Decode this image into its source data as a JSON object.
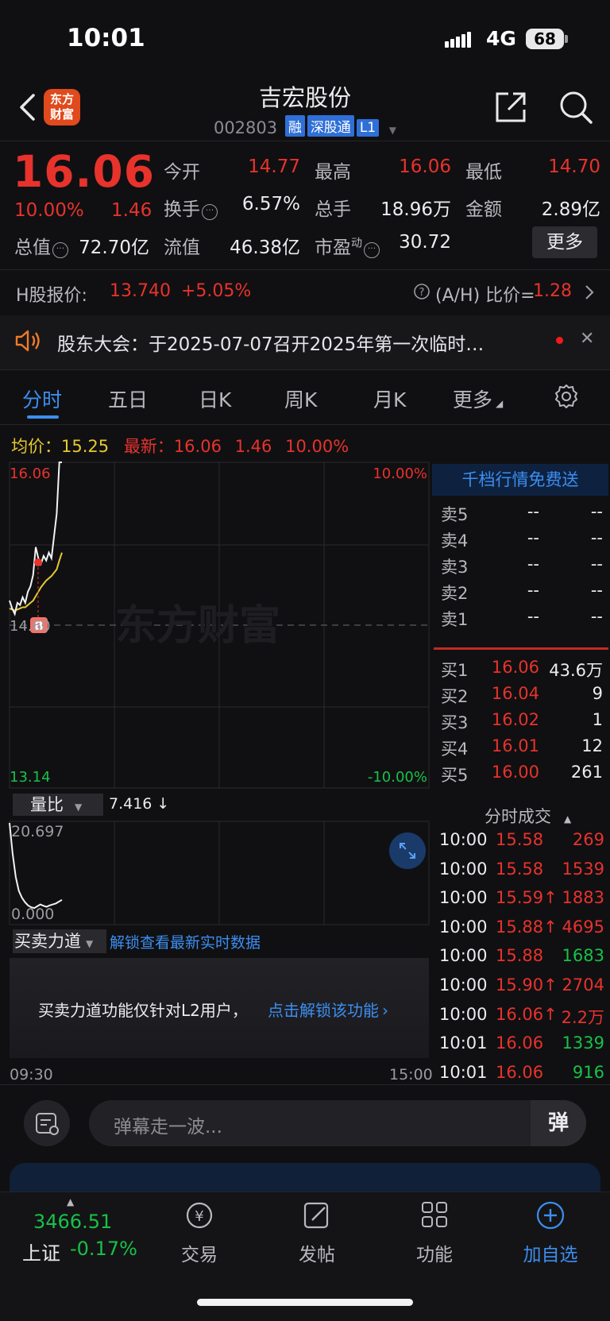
{
  "status_bar": {
    "time": "10:01",
    "network": "4G",
    "battery": "68"
  },
  "header": {
    "logo_text": "东方财富",
    "stock_name": "吉宏股份",
    "stock_code": "002803",
    "tags": [
      "融",
      "深股通",
      "L1"
    ]
  },
  "quote": {
    "price": "16.06",
    "change_pct": "10.00%",
    "change": "1.46",
    "fields": [
      {
        "label": "今开",
        "value": "14.77",
        "color": "red"
      },
      {
        "label": "最高",
        "value": "16.06",
        "color": "red"
      },
      {
        "label": "最低",
        "value": "14.70",
        "color": "red"
      },
      {
        "label": "换手",
        "value": "6.57%",
        "color": "white"
      },
      {
        "label": "总手",
        "value": "18.96万",
        "color": "white"
      },
      {
        "label": "金额",
        "value": "2.89亿",
        "color": "white"
      },
      {
        "label": "总值",
        "value": "72.70亿",
        "color": "white"
      },
      {
        "label": "流值",
        "value": "46.38亿",
        "color": "white"
      },
      {
        "label": "市盈",
        "value": "30.72",
        "color": "white"
      }
    ],
    "pe_superscript": "动",
    "more_label": "更多"
  },
  "hshare": {
    "label": "H股报价:",
    "price": "13.740",
    "pct": "+5.05%",
    "ah_label": "(A/H) 比价=",
    "ah_value": "1.28"
  },
  "notice": {
    "text": "股东大会：于2025-07-07召开2025年第一次临时…"
  },
  "tabs": [
    {
      "label": "分时",
      "active": true
    },
    {
      "label": "五日"
    },
    {
      "label": "日K"
    },
    {
      "label": "周K"
    },
    {
      "label": "月K"
    },
    {
      "label": "更多"
    }
  ],
  "chart_info": {
    "avg_label": "均价：",
    "avg_value": "15.25",
    "latest_label": "最新：",
    "latest_value": "16.06",
    "latest_change": "1.46",
    "latest_pct": "10.00%"
  },
  "chart_data": {
    "type": "line",
    "y_top_left": "16.06",
    "y_mid_left": "14.60",
    "y_bottom_left": "13.14",
    "y_top_right": "10.00%",
    "y_bottom_right": "-10.00%",
    "ylim": [
      13.14,
      16.06
    ],
    "x_start": "09:30",
    "x_end": "15:00",
    "watermark": "东方财富",
    "buy_marker": "B",
    "series": [
      {
        "values": [
          14.82,
          14.75,
          14.7,
          14.8,
          14.78,
          14.85,
          14.8,
          14.9,
          14.95,
          15.05,
          15.3,
          15.2,
          15.15,
          15.22,
          15.18,
          15.25,
          15.2,
          15.4,
          15.6,
          16.06,
          16.06
        ]
      },
      {
        "values": [
          14.75,
          14.74,
          14.73,
          14.74,
          14.75,
          14.76,
          14.76,
          14.78,
          14.8,
          14.82,
          14.86,
          14.9,
          14.94,
          14.97,
          15.0,
          15.02,
          15.04,
          15.07,
          15.1,
          15.18,
          15.25
        ]
      }
    ]
  },
  "volume_panel": {
    "indicator_label": "量比",
    "indicator_value": "7.416 ↓",
    "max": "20.697",
    "min": "0.000",
    "values": [
      20.697,
      14.0,
      9.0,
      6.0,
      4.5,
      3.5,
      2.8,
      2.4,
      2.2,
      2.6,
      3.0,
      2.7,
      2.5,
      2.8,
      3.0,
      3.2,
      3.6,
      4.0
    ]
  },
  "force_panel": {
    "label": "买卖力道",
    "unlock_link": "解锁查看最新实时数据",
    "lock_text": "买卖力道功能仅针对L2用户，",
    "lock_link": "点击解锁该功能"
  },
  "order_book": {
    "header": "千档行情免费送",
    "asks": [
      {
        "label": "卖5",
        "price": "--",
        "vol": "--"
      },
      {
        "label": "卖4",
        "price": "--",
        "vol": "--"
      },
      {
        "label": "卖3",
        "price": "--",
        "vol": "--"
      },
      {
        "label": "卖2",
        "price": "--",
        "vol": "--"
      },
      {
        "label": "卖1",
        "price": "--",
        "vol": "--"
      }
    ],
    "bids": [
      {
        "label": "买1",
        "price": "16.06",
        "vol": "43.6万"
      },
      {
        "label": "买2",
        "price": "16.04",
        "vol": "9"
      },
      {
        "label": "买3",
        "price": "16.02",
        "vol": "1"
      },
      {
        "label": "买4",
        "price": "16.01",
        "vol": "12"
      },
      {
        "label": "买5",
        "price": "16.00",
        "vol": "261"
      }
    ]
  },
  "ticks": {
    "header": "分时成交",
    "rows": [
      {
        "time": "10:00",
        "price": "15.58",
        "vol": "269",
        "vol_color": "red"
      },
      {
        "time": "10:00",
        "price": "15.58",
        "vol": "1539",
        "vol_color": "red"
      },
      {
        "time": "10:00",
        "price": "15.59↑",
        "vol": "1883",
        "vol_color": "red"
      },
      {
        "time": "10:00",
        "price": "15.88↑",
        "vol": "4695",
        "vol_color": "red"
      },
      {
        "time": "10:00",
        "price": "15.88",
        "vol": "1683",
        "vol_color": "green"
      },
      {
        "time": "10:00",
        "price": "15.90↑",
        "vol": "2704",
        "vol_color": "red"
      },
      {
        "time": "10:00",
        "price": "16.06↑",
        "vol": "2.2万",
        "vol_color": "red"
      },
      {
        "time": "10:01",
        "price": "16.06",
        "vol": "1339",
        "vol_color": "green"
      },
      {
        "time": "10:01",
        "price": "16.06",
        "vol": "916",
        "vol_color": "green"
      }
    ]
  },
  "danmaku": {
    "placeholder": "弹幕走一波...",
    "send_label": "弹"
  },
  "bottom_nav": {
    "index_value": "3466.51",
    "index_name": "上证",
    "index_pct": "-0.17%",
    "items": [
      "交易",
      "发帖",
      "功能",
      "加自选"
    ]
  },
  "colors": {
    "up": "#e8322c",
    "down": "#18c049",
    "accent": "#3c8ef0",
    "avg_line": "#e6c830"
  }
}
